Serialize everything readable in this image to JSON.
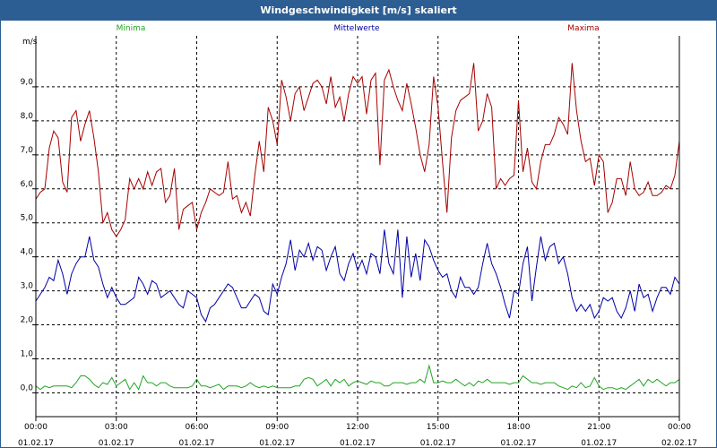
{
  "window": {
    "title": "Windgeschwindigkeit [m/s] skaliert"
  },
  "chart_data": {
    "type": "line",
    "title": "Windgeschwindigkeit [m/s] skaliert",
    "ylabel": "m/s",
    "xlabel": "",
    "ylim": [
      -0.7,
      10.5
    ],
    "xlim": [
      0,
      24
    ],
    "grid": true,
    "legend_position": "top",
    "y_ticks": [
      "0,0",
      "1,0",
      "2,0",
      "3,0",
      "4,0",
      "5,0",
      "6,0",
      "7,0",
      "8,0",
      "9,0"
    ],
    "y_tick_values": [
      0,
      1,
      2,
      3,
      4,
      5,
      6,
      7,
      8,
      9
    ],
    "x_ticks": [
      {
        "time": "00:00",
        "date": "01.02.17",
        "hour": 0
      },
      {
        "time": "03:00",
        "date": "01.02.17",
        "hour": 3
      },
      {
        "time": "06:00",
        "date": "01.02.17",
        "hour": 6
      },
      {
        "time": "09:00",
        "date": "01.02.17",
        "hour": 9
      },
      {
        "time": "12:00",
        "date": "01.02.17",
        "hour": 12
      },
      {
        "time": "15:00",
        "date": "01.02.17",
        "hour": 15
      },
      {
        "time": "18:00",
        "date": "01.02.17",
        "hour": 18
      },
      {
        "time": "21:00",
        "date": "01.02.17",
        "hour": 21
      },
      {
        "time": "00:00",
        "date": "02.02.17",
        "hour": 24
      }
    ],
    "x_step_hours": 0.16667,
    "series": [
      {
        "name": "Minima",
        "color": "#21a521",
        "values": [
          0.2,
          0.1,
          0.2,
          0.15,
          0.2,
          0.2,
          0.2,
          0.2,
          0.15,
          0.3,
          0.5,
          0.5,
          0.4,
          0.25,
          0.15,
          0.3,
          0.25,
          0.45,
          0.2,
          0.3,
          0.4,
          0.1,
          0.3,
          0.1,
          0.5,
          0.3,
          0.3,
          0.2,
          0.3,
          0.3,
          0.2,
          0.15,
          0.15,
          0.15,
          0.15,
          0.2,
          0.4,
          0.2,
          0.2,
          0.15,
          0.2,
          0.25,
          0.1,
          0.2,
          0.2,
          0.2,
          0.15,
          0.2,
          0.3,
          0.2,
          0.15,
          0.2,
          0.15,
          0.2,
          0.15,
          0.15,
          0.15,
          0.15,
          0.2,
          0.2,
          0.4,
          0.45,
          0.4,
          0.2,
          0.3,
          0.4,
          0.2,
          0.4,
          0.3,
          0.4,
          0.2,
          0.3,
          0.35,
          0.3,
          0.25,
          0.35,
          0.3,
          0.3,
          0.2,
          0.2,
          0.3,
          0.3,
          0.3,
          0.25,
          0.3,
          0.3,
          0.4,
          0.3,
          0.8,
          0.3,
          0.3,
          0.35,
          0.3,
          0.3,
          0.4,
          0.3,
          0.2,
          0.3,
          0.2,
          0.35,
          0.3,
          0.4,
          0.3,
          0.3,
          0.3,
          0.3,
          0.25,
          0.3,
          0.3,
          0.5,
          0.4,
          0.3,
          0.3,
          0.25,
          0.3,
          0.3,
          0.3,
          0.2,
          0.15,
          0.1,
          0.2,
          0.15,
          0.3,
          0.15,
          0.2,
          0.45,
          0.2,
          0.1,
          0.15,
          0.15,
          0.1,
          0.15,
          0.1,
          0.2,
          0.3,
          0.4,
          0.2,
          0.4,
          0.3,
          0.4,
          0.3,
          0.2,
          0.3,
          0.3,
          0.4,
          0.3,
          0.25,
          0.4,
          0.25,
          0.3,
          0.15,
          0.25,
          0.2,
          0.15,
          0.2,
          0.3,
          0.2,
          0.1,
          0.3,
          0.1,
          0.3,
          0.15,
          0.2,
          0.4,
          0.3,
          0.45,
          0.5
        ]
      },
      {
        "name": "Mittelwerte",
        "color": "#0000a6",
        "values": [
          2.7,
          2.9,
          3.1,
          3.4,
          3.3,
          3.9,
          3.5,
          2.9,
          3.5,
          3.8,
          4.0,
          4.0,
          4.6,
          3.9,
          3.7,
          3.2,
          2.8,
          3.1,
          2.8,
          2.6,
          2.6,
          2.7,
          2.8,
          3.4,
          3.2,
          2.9,
          3.3,
          3.2,
          2.8,
          2.9,
          3.0,
          2.8,
          2.6,
          2.5,
          3.0,
          2.9,
          2.8,
          2.3,
          2.1,
          2.5,
          2.6,
          2.8,
          3.0,
          3.2,
          3.1,
          2.8,
          2.5,
          2.5,
          2.7,
          2.9,
          2.8,
          2.4,
          2.3,
          3.2,
          2.9,
          3.4,
          3.8,
          4.5,
          3.6,
          4.2,
          4.0,
          4.4,
          3.9,
          4.3,
          4.2,
          3.6,
          4.0,
          4.3,
          3.5,
          3.3,
          3.8,
          4.1,
          3.6,
          3.9,
          3.5,
          4.1,
          4.0,
          3.5,
          4.8,
          3.8,
          3.5,
          4.8,
          2.8,
          4.6,
          3.4,
          4.1,
          3.3,
          4.5,
          4.3,
          3.9,
          3.6,
          3.4,
          3.5,
          3.0,
          2.8,
          3.4,
          3.1,
          3.1,
          2.9,
          3.1,
          3.8,
          4.4,
          3.8,
          3.5,
          3.1,
          2.6,
          2.2,
          3.0,
          2.9,
          3.8,
          4.3,
          2.7,
          3.7,
          4.6,
          3.9,
          4.3,
          4.4,
          3.8,
          4.0,
          3.5,
          2.8,
          2.4,
          2.6,
          2.4,
          2.6,
          2.2,
          2.4,
          2.8,
          2.7,
          2.8,
          2.4,
          2.2,
          2.5,
          3.0,
          2.4,
          3.2,
          2.8,
          2.9,
          2.4,
          2.8,
          3.1,
          3.1,
          2.9,
          3.4,
          3.2,
          2.9,
          3.4,
          3.1,
          3.0,
          3.0,
          3.2,
          3.7,
          3.4,
          3.3,
          3.8,
          3.6,
          3.1,
          2.9,
          2.8,
          3.1,
          3.2,
          3.0,
          2.8,
          2.5,
          2.8,
          3.5,
          3.0,
          3.2,
          3.5,
          3.7,
          3.6,
          3.7,
          3.6,
          3.2,
          3.4,
          2.9,
          3.0,
          2.9,
          3.3,
          2.8,
          2.6,
          2.8,
          2.5,
          2.4,
          2.7,
          2.9,
          2.6,
          3.3,
          3.4,
          3.2,
          3.5,
          3.7,
          4.0
        ]
      },
      {
        "name": "Maxima",
        "color": "#a60000",
        "values": [
          5.7,
          5.9,
          6.0,
          7.2,
          7.7,
          7.5,
          6.2,
          5.9,
          8.1,
          8.3,
          7.4,
          7.9,
          8.3,
          7.5,
          6.5,
          5.0,
          5.3,
          4.8,
          4.6,
          4.8,
          5.1,
          6.3,
          6.0,
          6.3,
          6.0,
          6.5,
          6.1,
          6.5,
          6.6,
          5.6,
          5.8,
          6.6,
          4.8,
          5.4,
          5.5,
          5.6,
          4.8,
          5.3,
          5.6,
          6.0,
          5.9,
          5.8,
          5.9,
          6.8,
          5.7,
          5.8,
          5.3,
          5.6,
          5.2,
          6.4,
          7.4,
          6.5,
          8.4,
          8.0,
          7.3,
          9.2,
          8.7,
          8.0,
          8.8,
          9.0,
          8.3,
          8.7,
          9.1,
          9.2,
          9.0,
          8.5,
          9.3,
          8.4,
          8.7,
          8.0,
          8.8,
          9.3,
          9.1,
          9.3,
          8.2,
          9.2,
          9.4,
          6.7,
          9.2,
          9.5,
          9.0,
          8.6,
          8.3,
          9.1,
          8.5,
          7.8,
          7.0,
          6.5,
          7.3,
          9.3,
          8.4,
          6.8,
          5.3,
          7.5,
          8.3,
          8.6,
          8.7,
          8.8,
          9.7,
          7.7,
          8.0,
          8.8,
          8.4,
          6.0,
          6.3,
          6.1,
          6.3,
          6.4,
          8.6,
          6.5,
          7.2,
          6.2,
          6.0,
          6.8,
          7.3,
          7.3,
          7.6,
          8.1,
          7.9,
          7.6,
          9.7,
          8.3,
          7.4,
          6.8,
          6.9,
          6.1,
          7.0,
          6.8,
          5.3,
          5.6,
          6.3,
          6.3,
          5.8,
          6.8,
          6.0,
          5.8,
          5.9,
          6.2,
          5.8,
          5.8,
          5.9,
          6.1,
          6.0,
          6.4,
          7.4,
          7.6,
          7.2
        ]
      }
    ]
  }
}
